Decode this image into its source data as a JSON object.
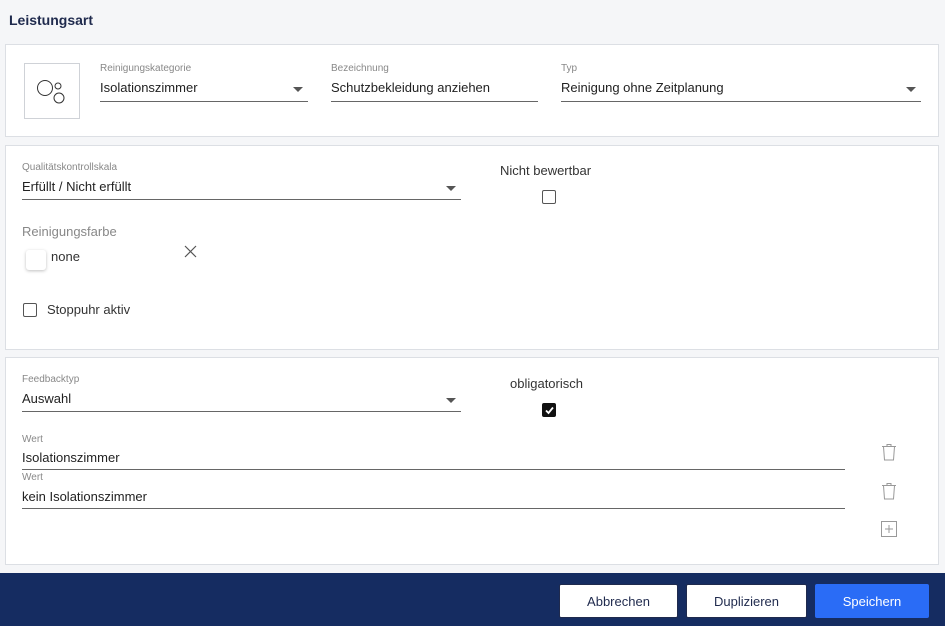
{
  "page": {
    "title": "Leistungsart"
  },
  "general": {
    "category": {
      "label": "Reinigungskategorie",
      "value": "Isolationszimmer"
    },
    "name": {
      "label": "Bezeichnung",
      "value": "Schutzbekleidung anziehen"
    },
    "type": {
      "label": "Typ",
      "value": "Reinigung ohne Zeitplanung"
    }
  },
  "quality": {
    "scale": {
      "label": "Qualitätskontrollskala",
      "value": "Erfüllt / Nicht erfüllt"
    },
    "not_ratable": {
      "label": "Nicht bewertbar",
      "checked": false
    },
    "color": {
      "label": "Reinigungsfarbe",
      "value": "none"
    },
    "stopwatch": {
      "label": "Stoppuhr aktiv",
      "checked": false
    }
  },
  "feedback": {
    "type": {
      "label": "Feedbacktyp",
      "value": "Auswahl"
    },
    "mandatory": {
      "label": "obligatorisch",
      "checked": true
    },
    "values": [
      {
        "label": "Wert",
        "value": "Isolationszimmer"
      },
      {
        "label": "Wert",
        "value": "kein Isolationszimmer"
      }
    ]
  },
  "footer": {
    "cancel": "Abbrechen",
    "duplicate": "Duplizieren",
    "save": "Speichern"
  },
  "colors": {
    "footer_bg": "#152c61",
    "primary": "#2a6cf6",
    "title": "#1f2a4d"
  }
}
